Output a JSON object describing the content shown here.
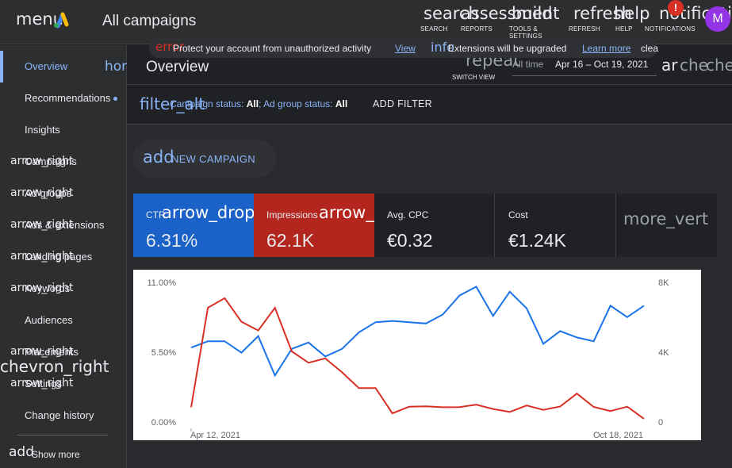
{
  "topbar": {
    "menu_icon": "menu",
    "title": "All campaigns",
    "tools": [
      {
        "icon": "search",
        "label": "SEARCH"
      },
      {
        "icon": "assessment",
        "label": "REPORTS"
      },
      {
        "icon": "build",
        "label": "TOOLS & SETTINGS"
      },
      {
        "icon": "refresh",
        "label": "REFRESH"
      },
      {
        "icon": "help",
        "label": "HELP"
      },
      {
        "icon": "notifications",
        "label": "NOTIFICATIONS"
      }
    ],
    "notification_badge": "!",
    "avatar_letter": "M"
  },
  "banner": {
    "error_icon": "error",
    "message": "Protect your account from unauthorized activity",
    "view_link": "View",
    "info_icon": "info",
    "message2": "Extensions will be upgraded",
    "learn_more": "Learn more",
    "close_icon": "clea"
  },
  "sidebar": {
    "items": [
      {
        "label": "Overview",
        "arrow": ""
      },
      {
        "label": "Recommendations",
        "arrow": ""
      },
      {
        "label": "Insights",
        "arrow": ""
      },
      {
        "label": "Campaigns",
        "arrow": "arrow_right"
      },
      {
        "label": "Ad groups",
        "arrow": "arrow_right"
      },
      {
        "label": "Ads & extensions",
        "arrow": "arrow_right"
      },
      {
        "label": "Landing pages",
        "arrow": "arrow_right"
      },
      {
        "label": "Keywords",
        "arrow": "arrow_right"
      },
      {
        "label": "Audiences",
        "arrow": ""
      },
      {
        "label": "Placements",
        "arrow": "arrow_right"
      },
      {
        "label": "Settings",
        "arrow": "arrow_right"
      },
      {
        "label": "Change history",
        "arrow": ""
      }
    ],
    "show_more_icon": "add",
    "show_more": "Show more",
    "collapse_icon": "chevron_right"
  },
  "header": {
    "home_icon": "hor",
    "title": "Overview",
    "switch_view_icon": "repeat",
    "switch_view_label": "SWITCH VIEW",
    "date_preset": "All time",
    "date_range": "Apr 16 – Oct 19, 2021",
    "archive_icon": "ar",
    "check_icon": "che",
    "chevron_icon": "che"
  },
  "filter": {
    "icon": "filter_alt",
    "campaign_status_label": "Campaign status:",
    "campaign_status_value": "All",
    "ad_group_status_label": "; Ad group status:",
    "ad_group_status_value": "All",
    "add_filter": "ADD FILTER"
  },
  "new_campaign": {
    "icon": "add",
    "label": "NEW CAMPAIGN"
  },
  "metrics": [
    {
      "name": "CTR",
      "value": "6.31%",
      "color": "#1a62c7",
      "icon": "arrow_drop"
    },
    {
      "name": "Impressions",
      "value": "62.1K",
      "color": "#b3261e",
      "icon": "arrow_"
    },
    {
      "name": "Avg. CPC",
      "value": "€0.32",
      "color": "#202124",
      "icon": ""
    },
    {
      "name": "Cost",
      "value": "€1.24K",
      "color": "#202124",
      "icon": ""
    }
  ],
  "more_icon": "more_vert",
  "chart_data": {
    "type": "line",
    "x_labels": [
      "Apr 12, 2021",
      "Oct 18, 2021"
    ],
    "y_left_ticks": [
      "11.00%",
      "5.50%",
      "0.00%"
    ],
    "y_right_ticks": [
      "8K",
      "4K",
      "0"
    ],
    "ylim_left": [
      0,
      11
    ],
    "ylim_right": [
      0,
      8000
    ],
    "grid": false,
    "series": [
      {
        "name": "CTR",
        "axis": "left",
        "color": "#1a73e8",
        "values": [
          5.8,
          6.3,
          6.3,
          5.4,
          6.7,
          3.6,
          5.7,
          6.2,
          5.1,
          5.7,
          7.0,
          7.8,
          7.9,
          7.8,
          7.7,
          8.4,
          9.9,
          10.6,
          8.3,
          10.2,
          8.9,
          6.1,
          7.1,
          6.6,
          6.3,
          9.1,
          8.2,
          9.1
        ]
      },
      {
        "name": "Impressions",
        "axis": "right",
        "color": "#d93025",
        "values": [
          800,
          6500,
          7050,
          5700,
          5200,
          6500,
          4000,
          3350,
          3600,
          2800,
          1900,
          1900,
          450,
          830,
          850,
          800,
          810,
          950,
          700,
          530,
          900,
          650,
          840,
          1580,
          820,
          580,
          830,
          140
        ]
      }
    ]
  }
}
